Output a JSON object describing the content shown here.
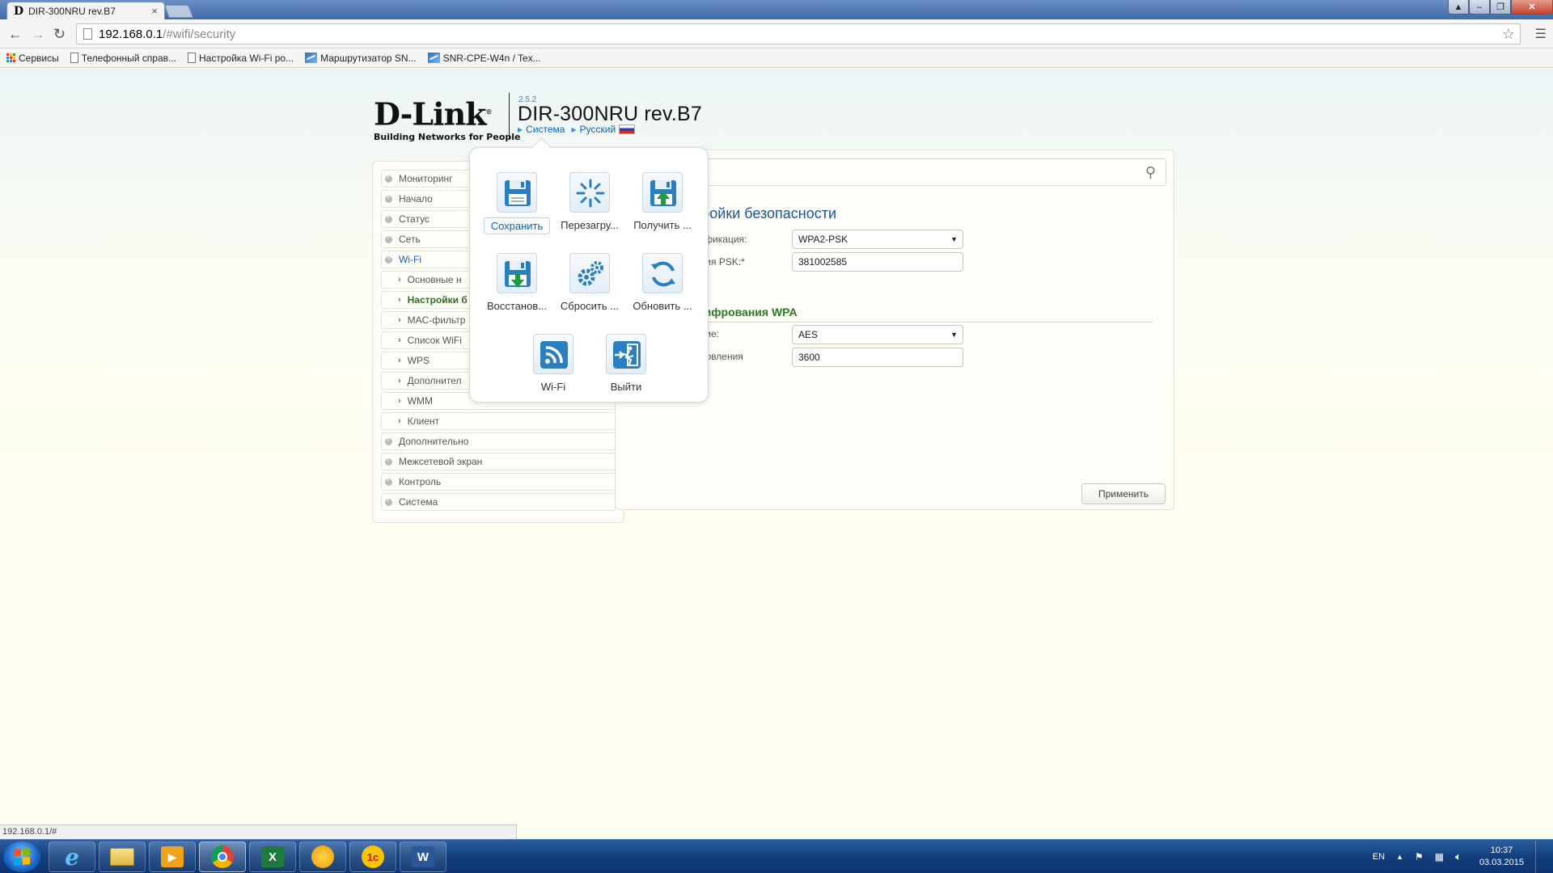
{
  "browser": {
    "tab_title": "DIR-300NRU rev.B7",
    "tab_favicon": "D",
    "tab_close": "×",
    "url_host": "192.168.0.1",
    "url_path": "/#wifi/security",
    "bookmarks": [
      {
        "label": "Сервисы",
        "icon": "apps-icon"
      },
      {
        "label": "Телефонный справ...",
        "icon": "page-icon"
      },
      {
        "label": "Настройка Wi-Fi ро...",
        "icon": "page-icon"
      },
      {
        "label": "Маршрутизатор SN...",
        "icon": "snr-icon"
      },
      {
        "label": "SNR-CPE-W4n / Tex...",
        "icon": "snr-icon"
      }
    ],
    "status_url": "192.168.0.1/#"
  },
  "header": {
    "logo_word": "D-Link",
    "logo_reg": "®",
    "logo_tagline": "Building Networks for People",
    "firmware": "2.5.2",
    "model": "DIR-300NRU rev.B7",
    "crumb_system": "Система",
    "crumb_language": "Русский"
  },
  "sidebar": {
    "items": [
      {
        "label": "Мониторинг"
      },
      {
        "label": "Начало"
      },
      {
        "label": "Статус"
      },
      {
        "label": "Сеть"
      },
      {
        "label": "Wi-Fi"
      },
      {
        "label": "Основные н"
      },
      {
        "label": "Настройки б"
      },
      {
        "label": "MAC-фильтр"
      },
      {
        "label": "Список WiFi"
      },
      {
        "label": "WPS"
      },
      {
        "label": "Дополнител"
      },
      {
        "label": "WMM"
      },
      {
        "label": "Клиент"
      },
      {
        "label": "Дополнительно"
      },
      {
        "label": "Межсетевой экран"
      },
      {
        "label": "Контроль"
      },
      {
        "label": "Система"
      }
    ]
  },
  "content": {
    "title": "тройки безопасности",
    "auth_label": "тификация:",
    "auth_value": "WPA2-PSK",
    "psk_label": "ания PSK:*",
    "psk_value": "381002585",
    "wpa_group": "шифрования WPA",
    "enc_label": "ание:",
    "enc_value": "AES",
    "renew_label": "бновления",
    "renew_value": "3600",
    "apply_label": "Применить"
  },
  "popup": {
    "items": [
      {
        "label": "Сохранить",
        "icon": "save-icon"
      },
      {
        "label": "Перезагру...",
        "icon": "reboot-icon"
      },
      {
        "label": "Получить ...",
        "icon": "backup-download-icon"
      },
      {
        "label": "Восстанов...",
        "icon": "restore-icon"
      },
      {
        "label": "Сбросить ...",
        "icon": "factory-reset-icon"
      },
      {
        "label": "Обновить ...",
        "icon": "firmware-update-icon"
      },
      {
        "label": "Wi-Fi",
        "icon": "wifi-icon"
      },
      {
        "label": "Выйти",
        "icon": "logout-icon"
      }
    ]
  },
  "taskbar": {
    "language": "EN",
    "time": "10:37",
    "date": "03.03.2015"
  },
  "colors": {
    "accent_blue": "#0a63b5",
    "group_green": "#2e7a24",
    "taskbar_blue": "#133f7c"
  }
}
